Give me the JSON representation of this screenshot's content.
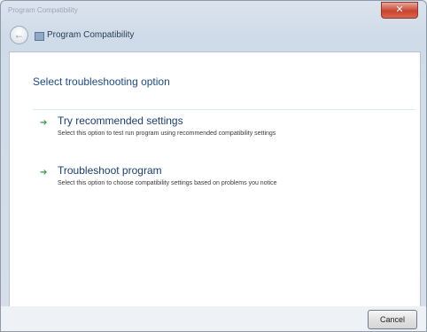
{
  "window": {
    "title_ghost": "Program Compatibility",
    "close_label": "✕"
  },
  "nav": {
    "back_glyph": "←",
    "title": "Program Compatibility"
  },
  "main": {
    "heading": "Select troubleshooting option",
    "options": [
      {
        "title": "Try recommended settings",
        "description": "Select this option to test run program using recommended compatibility settings",
        "icon": "green-arrow-icon"
      },
      {
        "title": "Troubleshoot program",
        "description": "Select this option to choose compatibility settings based on problems you notice",
        "icon": "green-arrow-icon"
      }
    ]
  },
  "footer": {
    "cancel_label": "Cancel"
  },
  "colors": {
    "heading": "#1d4a88",
    "arrow": "#2f9b43",
    "close": "#c8452f"
  }
}
